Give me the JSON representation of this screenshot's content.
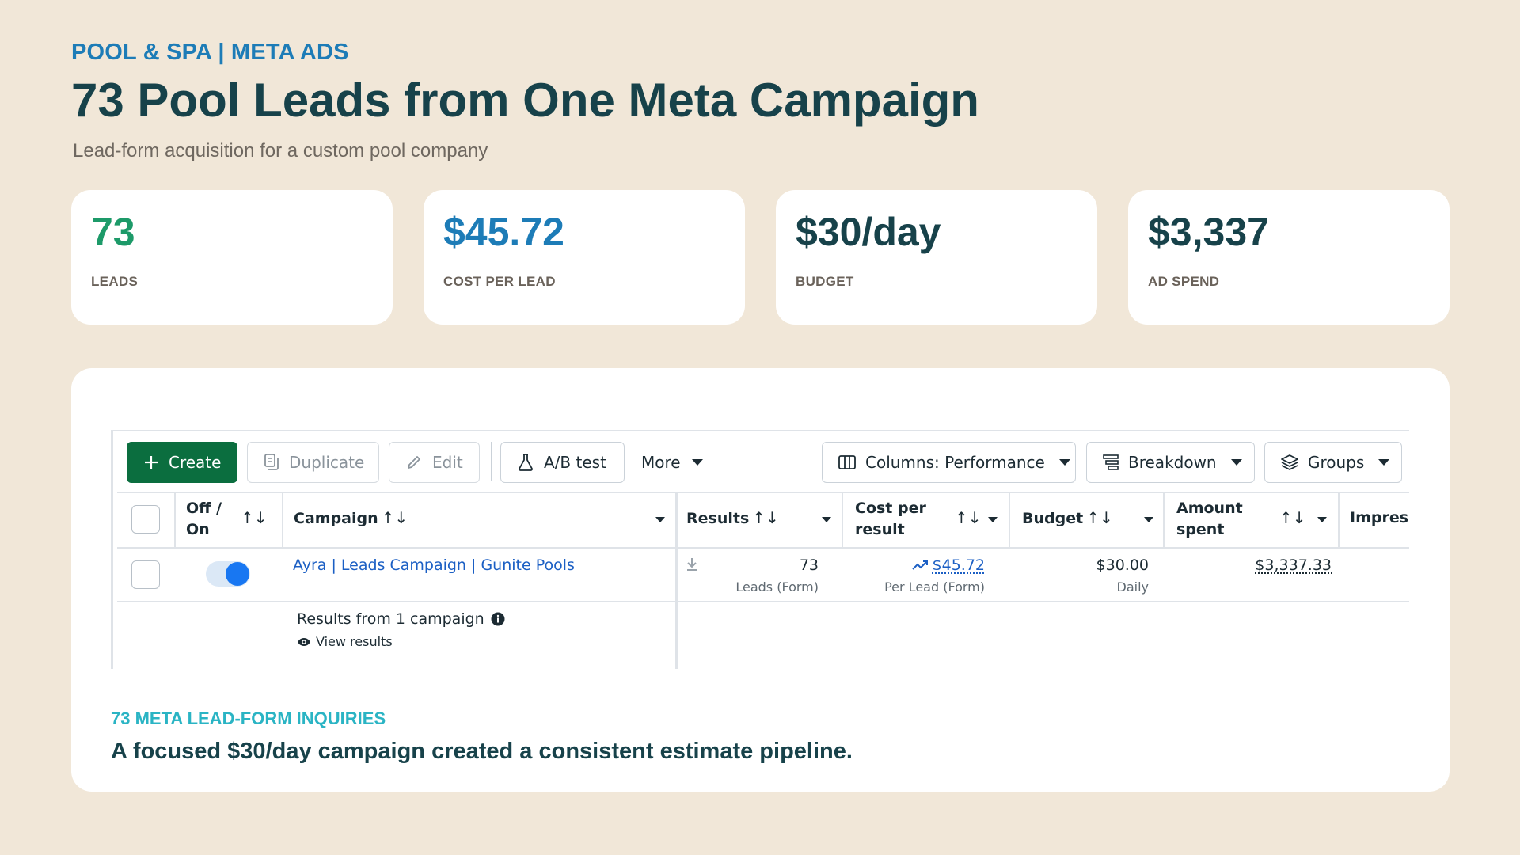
{
  "header": {
    "eyebrow": "POOL & SPA | META ADS",
    "title": "73 Pool Leads from One Meta Campaign",
    "subtitle": "Lead-form acquisition for a custom pool company"
  },
  "stats": [
    {
      "value": "73",
      "label": "LEADS",
      "color": "#1d9a69"
    },
    {
      "value": "$45.72",
      "label": "COST PER LEAD",
      "color": "#1d7cb7"
    },
    {
      "value": "$30/day",
      "label": "BUDGET",
      "color": "#17424a"
    },
    {
      "value": "$3,337",
      "label": "AD SPEND",
      "color": "#17424a"
    }
  ],
  "toolbar": {
    "create": "Create",
    "duplicate": "Duplicate",
    "edit": "Edit",
    "ab_test": "A/B test",
    "more": "More",
    "columns": "Columns: Performance",
    "breakdown": "Breakdown",
    "groups": "Groups"
  },
  "table": {
    "headers": {
      "off_on": "Off / On",
      "campaign": "Campaign",
      "results": "Results",
      "cost_per_result": "Cost per result",
      "budget": "Budget",
      "amount_spent": "Amount spent",
      "impressions": "Impress"
    },
    "row": {
      "campaign": "Ayra | Leads Campaign | Gunite Pools",
      "toggle_on": true,
      "results": "73",
      "results_sub": "Leads (Form)",
      "cost": "$45.72",
      "cost_sub": "Per Lead (Form)",
      "budget": "$30.00",
      "budget_sub": "Daily",
      "spent": "$3,337.33"
    },
    "summary": {
      "text": "Results from 1 campaign",
      "view": "View results"
    }
  },
  "footer": {
    "eyebrow": "73 META LEAD-FORM INQUIRIES",
    "text": "A focused $30/day campaign created a consistent estimate pipeline."
  },
  "colors": {
    "background": "#f1e7d8",
    "create_button": "#0b6e3f",
    "link": "#1b5fc4",
    "toggle": "#1877f2"
  }
}
